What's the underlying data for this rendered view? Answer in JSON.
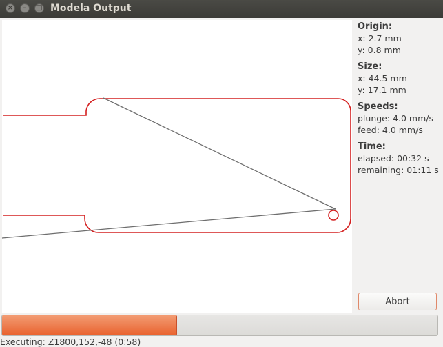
{
  "window": {
    "title": "Modela Output",
    "close_glyph": "×",
    "minimize_glyph": "–",
    "maximize_glyph": "□"
  },
  "info": {
    "origin": {
      "heading": "Origin:",
      "x": "x: 2.7 mm",
      "y": "y: 0.8 mm"
    },
    "size": {
      "heading": "Size:",
      "x": "x: 44.5 mm",
      "y": "y: 17.1 mm"
    },
    "speeds": {
      "heading": "Speeds:",
      "plunge": "plunge: 4.0 mm/s",
      "feed": "feed: 4.0 mm/s"
    },
    "time": {
      "heading": "Time:",
      "elapsed": "elapsed: 00:32 s",
      "remaining": "remaining: 01:11 s"
    }
  },
  "controls": {
    "abort_label": "Abort"
  },
  "progress": {
    "fraction": 0.4,
    "fill_color": "#e9622e"
  },
  "status": {
    "text": "Executing: Z1800,152,-48 (0:58)"
  },
  "colors": {
    "toolpath_outline": "#d42020",
    "travel_path": "#6e6e6e",
    "canvas_background": "#ffffff",
    "titlebar": "#3c3b37"
  }
}
